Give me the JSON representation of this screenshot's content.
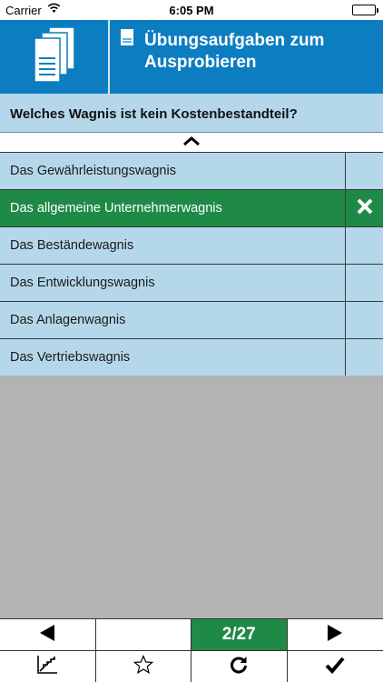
{
  "status_bar": {
    "carrier": "Carrier",
    "time": "6:05 PM"
  },
  "header": {
    "title_line1": "Übungsaufgaben zum",
    "title_line2": "Ausprobieren",
    "logo_icon": "documents-stack-icon",
    "title_icon": "document-icon"
  },
  "question": {
    "text": "Welches Wagnis ist kein Kostenbestandteil?"
  },
  "answers": [
    {
      "label": "Das Gewährleistungswagnis",
      "selected": false,
      "mark": ""
    },
    {
      "label": "Das allgemeine Unternehmerwagnis",
      "selected": true,
      "mark": "close-icon"
    },
    {
      "label": "Das Beständewagnis",
      "selected": false,
      "mark": ""
    },
    {
      "label": "Das Entwicklungswagnis",
      "selected": false,
      "mark": ""
    },
    {
      "label": "Das Anlagenwagnis",
      "selected": false,
      "mark": ""
    },
    {
      "label": "Das Vertriebswagnis",
      "selected": false,
      "mark": ""
    }
  ],
  "toolbar": {
    "counter": "2/27",
    "icons": [
      "previous-arrow-icon",
      "next-arrow-icon",
      "statistics-chart-icon",
      "star-icon",
      "refresh-icon",
      "checkmark-icon"
    ]
  },
  "colors": {
    "header_blue": "#0c7dc0",
    "answer_bg": "#b4d8ea",
    "selected_green": "#1f8a47",
    "gray": "#b3b3b3"
  }
}
